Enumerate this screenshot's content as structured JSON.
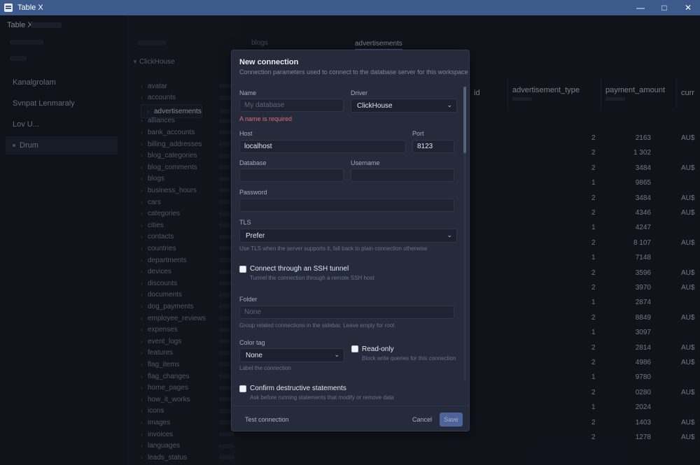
{
  "window": {
    "title": "Table X"
  },
  "left": {
    "brand": "Table X",
    "connections": [
      {
        "label": "Kanalgrolam"
      },
      {
        "label": "Svnpat Lenmaraly"
      },
      {
        "label": "Lov U..."
      },
      {
        "label": "Drum"
      }
    ]
  },
  "tree": {
    "root": "ClickHouse",
    "items": [
      "avatar",
      "accounts",
      "advertisements",
      "alliances",
      "bank_accounts",
      "billing_addresses",
      "blog_categories",
      "blog_comments",
      "blogs",
      "business_hours",
      "cars",
      "categories",
      "cities",
      "contacts",
      "countries",
      "departments",
      "devices",
      "discounts",
      "documents",
      "dog_payments",
      "employee_reviews",
      "expenses",
      "event_logs",
      "features",
      "flag_items",
      "flag_changes",
      "home_pages",
      "how_it_works",
      "icons",
      "images",
      "invoices",
      "languages",
      "leads_status"
    ],
    "selected_index": 2
  },
  "tabs": [
    "blogs",
    "advertisements"
  ],
  "grid": {
    "columns": [
      {
        "label": "id"
      },
      {
        "label": "advertisement_type"
      },
      {
        "label": "payment_amount"
      },
      {
        "label": "curr"
      }
    ],
    "rows": [
      [
        "2",
        "2163",
        "AU$"
      ],
      [
        "2",
        "1 302",
        ""
      ],
      [
        "2",
        "3484",
        "AU$"
      ],
      [
        "1",
        "9865",
        ""
      ],
      [
        "2",
        "3484",
        "AU$"
      ],
      [
        "2",
        "4346",
        "AU$"
      ],
      [
        "1",
        "4247",
        ""
      ],
      [
        "2",
        "8 107",
        "AU$"
      ],
      [
        "1",
        "7148",
        ""
      ],
      [
        "2",
        "3596",
        "AU$"
      ],
      [
        "2",
        "3970",
        "AU$"
      ],
      [
        "1",
        "2874",
        ""
      ],
      [
        "2",
        "8849",
        "AU$"
      ],
      [
        "1",
        "3097",
        ""
      ],
      [
        "2",
        "2814",
        "AU$"
      ],
      [
        "2",
        "4986",
        "AU$"
      ],
      [
        "1",
        "9780",
        ""
      ],
      [
        "2",
        "0280",
        "AU$"
      ],
      [
        "1",
        "2024",
        ""
      ],
      [
        "2",
        "1403",
        "AU$"
      ],
      [
        "2",
        "1278",
        "AU$"
      ]
    ]
  },
  "modal": {
    "title": "New connection",
    "description": "Connection parameters used to connect to the database server for this workspace",
    "name_label": "Name",
    "name_placeholder": "My database",
    "name_error": "A name is required",
    "driver_label": "Driver",
    "driver_value": "ClickHouse",
    "host_label": "Host",
    "host_value": "localhost",
    "port_label": "Port",
    "port_value": "8123",
    "database_label": "Database",
    "username_label": "Username",
    "password_label": "Password",
    "tls_label": "TLS",
    "tls_value": "Prefer",
    "tls_hint": "Use TLS when the server supports it, fall back to plain connection otherwise",
    "ssh_label": "Connect through an SSH tunnel",
    "ssh_hint": "Tunnel the connection through a remote SSH host",
    "folder_label": "Folder",
    "folder_placeholder": "None",
    "folder_hint": "Group related connections in the sidebar. Leave empty for root",
    "color_label": "Color tag",
    "color_value": "None",
    "color_hint": "Label the connection",
    "readonly_label": "Read-only",
    "readonly_hint": "Block write queries for this connection",
    "confirm_label": "Confirm destructive statements",
    "confirm_hint": "Ask before running statements that modify or remove data",
    "test_button": "Test connection",
    "cancel_button": "Cancel",
    "save_button": "Save"
  }
}
